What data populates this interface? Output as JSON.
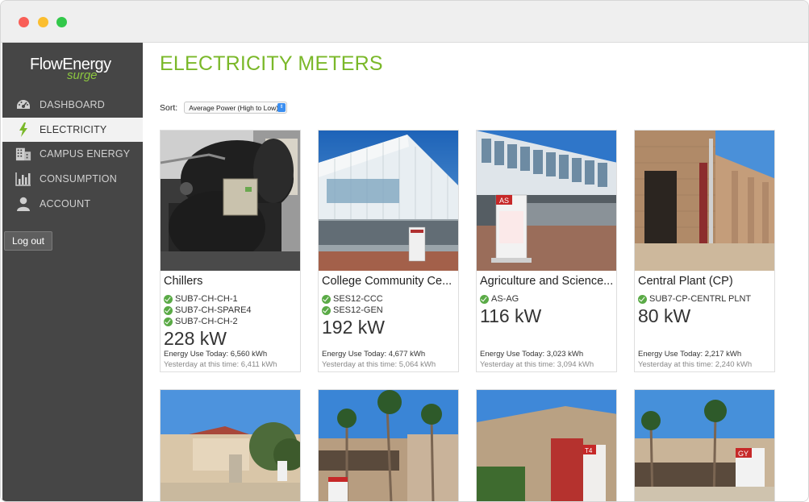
{
  "sidebar": {
    "logo_main": "FlowEnergy",
    "logo_sub": "surge",
    "items": [
      {
        "label": "DASHBOARD",
        "icon": "dashboard-gauge-icon"
      },
      {
        "label": "ELECTRICITY",
        "icon": "lightning-bolt-icon",
        "active": true
      },
      {
        "label": "CAMPUS ENERGY",
        "icon": "building-icon"
      },
      {
        "label": "CONSUMPTION",
        "icon": "bar-chart-icon"
      },
      {
        "label": "ACCOUNT",
        "icon": "user-icon"
      }
    ],
    "logout_label": "Log out"
  },
  "main": {
    "title": "ELECTRICITY METERS",
    "sort_label": "Sort:",
    "sort_value": "Average Power (High to Low)"
  },
  "cards": [
    {
      "name": "Chillers",
      "meters": [
        "SUB7-CH-CH-1",
        "SUB7-CH-SPARE4",
        "SUB7-CH-CH-2"
      ],
      "power": "228 kW",
      "energy_today": "Energy Use Today: 6,560 kWh",
      "yesterday": "Yesterday at this time: 6,411 kWh"
    },
    {
      "name": "College Community Ce...",
      "meters": [
        "SES12-CCC",
        "SES12-GEN"
      ],
      "power": "192 kW",
      "energy_today": "Energy Use Today: 4,677 kWh",
      "yesterday": "Yesterday at this time: 5,064 kWh"
    },
    {
      "name": "Agriculture and Science...",
      "meters": [
        "AS-AG"
      ],
      "power": "116 kW",
      "energy_today": "Energy Use Today: 3,023 kWh",
      "yesterday": "Yesterday at this time: 3,094 kWh"
    },
    {
      "name": "Central Plant (CP)",
      "meters": [
        "SUB7-CP-CENTRL PLNT"
      ],
      "power": "80 kW",
      "energy_today": "Energy Use Today: 2,217 kWh",
      "yesterday": "Yesterday at this time: 2,240 kWh"
    }
  ],
  "photo_signs": {
    "card3": "AS",
    "row2_card3": "T4",
    "row2_card4": "GY"
  },
  "colors": {
    "accent": "#7ab829",
    "sidebar_bg": "#464646",
    "check": "#5aaa46"
  }
}
